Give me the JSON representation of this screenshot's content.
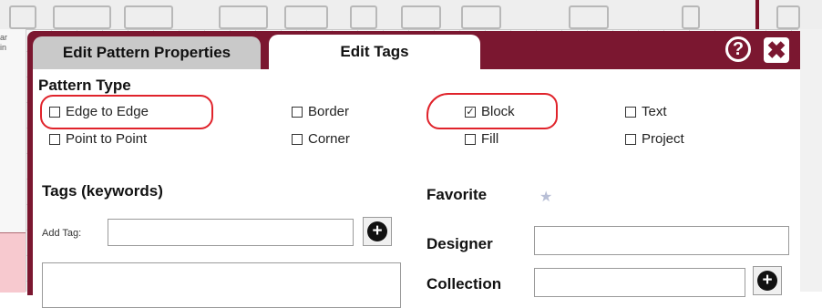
{
  "tabs": {
    "properties_label": "Edit Pattern Properties",
    "tags_label": "Edit Tags"
  },
  "header": {
    "help_glyph": "?",
    "close_glyph": "✖"
  },
  "pattern_type": {
    "title": "Pattern Type",
    "options": [
      {
        "label": "Edge to Edge",
        "checked": false
      },
      {
        "label": "Border",
        "checked": false
      },
      {
        "label": "Block",
        "checked": true
      },
      {
        "label": "Text",
        "checked": false
      },
      {
        "label": "Point to Point",
        "checked": false
      },
      {
        "label": "Corner",
        "checked": false
      },
      {
        "label": "Fill",
        "checked": false
      },
      {
        "label": "Project",
        "checked": false
      }
    ]
  },
  "tags": {
    "title": "Tags (keywords)",
    "add_label": "Add Tag:",
    "add_value": ""
  },
  "favorite": {
    "label": "Favorite",
    "icon": "star-icon"
  },
  "designer": {
    "label": "Designer",
    "value": ""
  },
  "collection": {
    "label": "Collection",
    "value": ""
  },
  "background": {
    "side_text_1": "ar",
    "side_text_2": "in"
  },
  "colors": {
    "dialog_maroon": "#7b1730",
    "annotation_red": "#e0232b",
    "inactive_tab": "#c9c9c9"
  }
}
